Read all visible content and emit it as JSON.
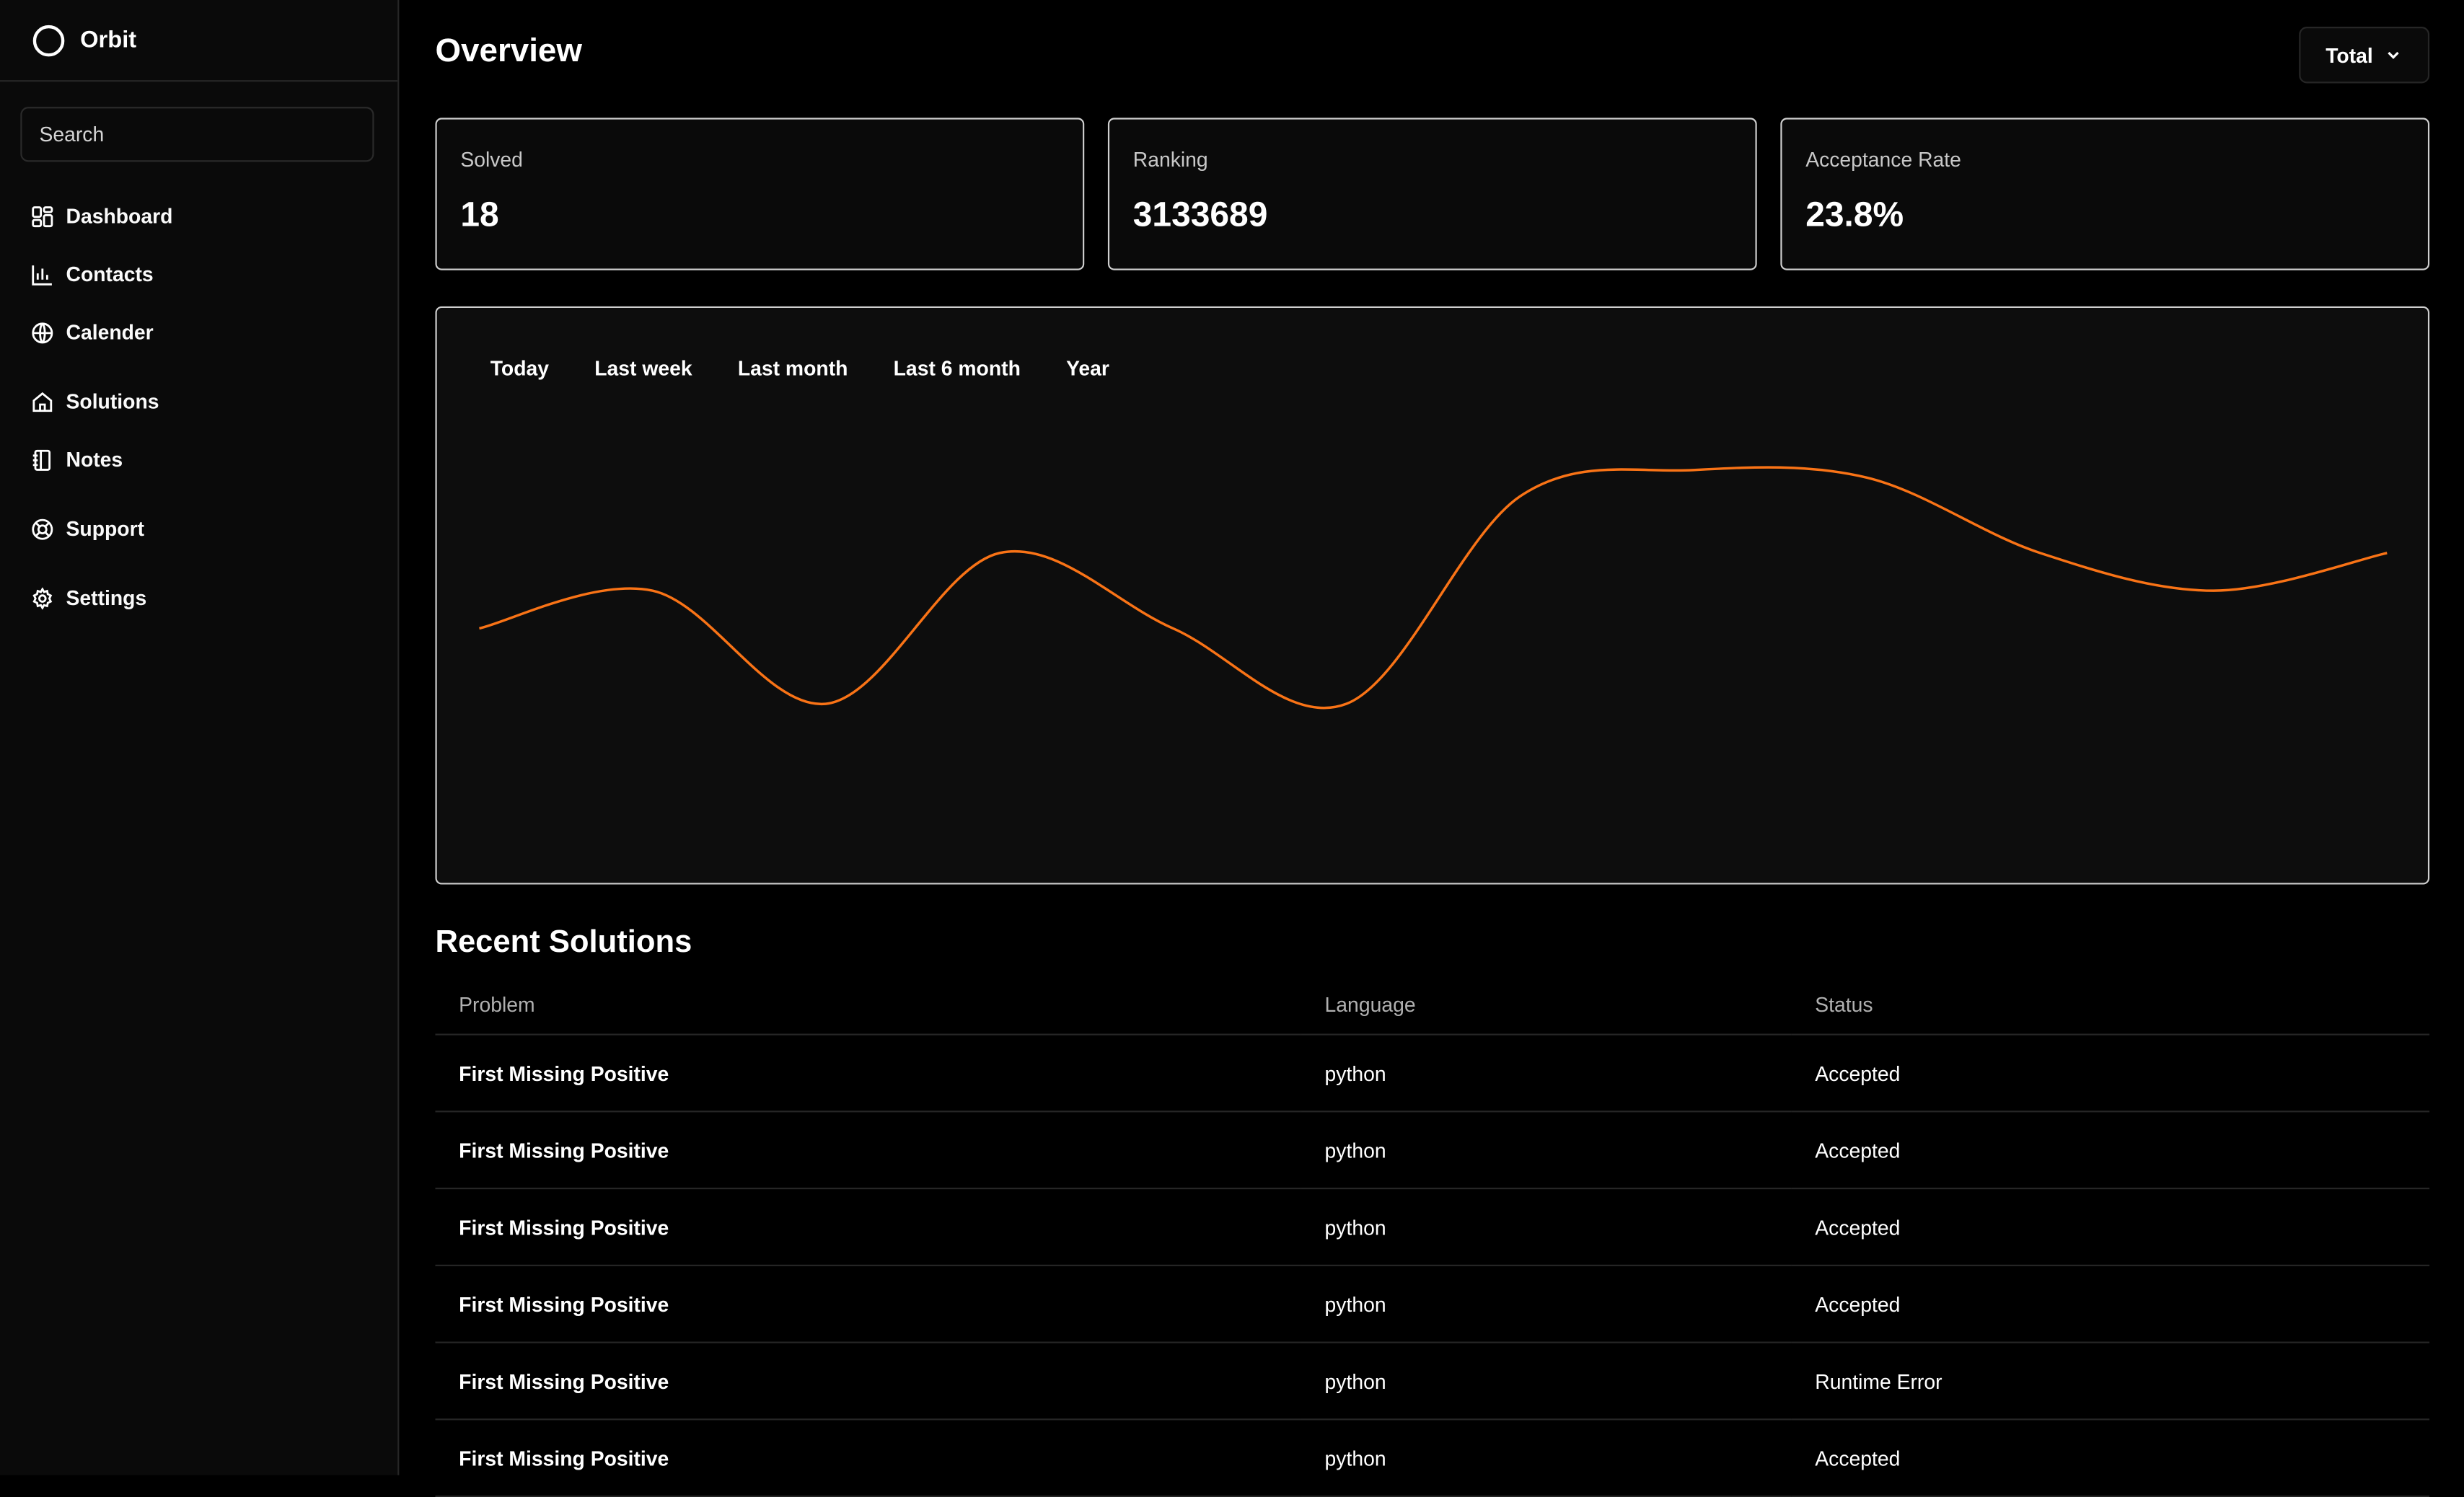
{
  "app": {
    "name": "Orbit"
  },
  "search": {
    "placeholder": "Search"
  },
  "sidebar": {
    "items": [
      {
        "label": "Dashboard",
        "icon": "dashboard-icon"
      },
      {
        "label": "Contacts",
        "icon": "bar-chart-icon"
      },
      {
        "label": "Calender",
        "icon": "globe-icon"
      },
      {
        "label": "Solutions",
        "icon": "home-icon"
      },
      {
        "label": "Notes",
        "icon": "notebook-icon"
      },
      {
        "label": "Support",
        "icon": "lifebuoy-icon"
      },
      {
        "label": "Settings",
        "icon": "gear-icon"
      }
    ]
  },
  "header": {
    "title": "Overview",
    "filter_label": "Total"
  },
  "stats": [
    {
      "label": "Solved",
      "value": "18"
    },
    {
      "label": "Ranking",
      "value": "3133689"
    },
    {
      "label": "Acceptance Rate",
      "value": "23.8%"
    }
  ],
  "chart": {
    "tabs": [
      "Today",
      "Last week",
      "Last month",
      "Last 6 month",
      "Year"
    ]
  },
  "chart_data": {
    "type": "line",
    "x": [
      0,
      1,
      2,
      3,
      4,
      5,
      6,
      7,
      8,
      9,
      10,
      11
    ],
    "values": [
      40,
      50,
      20,
      60,
      40,
      20,
      75,
      82,
      80,
      60,
      50,
      60
    ],
    "color": "#f97316",
    "grid": false,
    "title": "",
    "xlabel": "",
    "ylabel": ""
  },
  "solutions": {
    "title": "Recent Solutions",
    "columns": [
      "Problem",
      "Language",
      "Status"
    ],
    "rows": [
      {
        "problem": "First Missing Positive",
        "language": "python",
        "status": "Accepted"
      },
      {
        "problem": "First Missing Positive",
        "language": "python",
        "status": "Accepted"
      },
      {
        "problem": "First Missing Positive",
        "language": "python",
        "status": "Accepted"
      },
      {
        "problem": "First Missing Positive",
        "language": "python",
        "status": "Accepted"
      },
      {
        "problem": "First Missing Positive",
        "language": "python",
        "status": "Runtime Error"
      },
      {
        "problem": "First Missing Positive",
        "language": "python",
        "status": "Accepted"
      }
    ]
  }
}
